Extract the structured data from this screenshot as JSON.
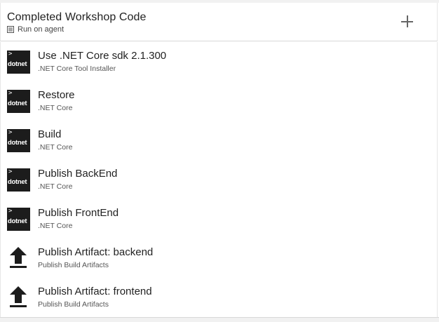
{
  "header": {
    "title": "Completed Workshop Code",
    "subtitle": "Run on agent",
    "subtitle_icon": "server-icon",
    "add_icon": "plus-icon"
  },
  "tasks": [
    {
      "name": "Use .NET Core sdk 2.1.300",
      "description": ".NET Core Tool Installer",
      "icon": "dotnet-icon",
      "icon_label": "dotnet",
      "icon_prompt": ">"
    },
    {
      "name": "Restore",
      "description": ".NET Core",
      "icon": "dotnet-icon",
      "icon_label": "dotnet",
      "icon_prompt": ">"
    },
    {
      "name": "Build",
      "description": ".NET Core",
      "icon": "dotnet-icon",
      "icon_label": "dotnet",
      "icon_prompt": ">"
    },
    {
      "name": "Publish BackEnd",
      "description": ".NET Core",
      "icon": "dotnet-icon",
      "icon_label": "dotnet",
      "icon_prompt": ">"
    },
    {
      "name": "Publish FrontEnd",
      "description": ".NET Core",
      "icon": "dotnet-icon",
      "icon_label": "dotnet",
      "icon_prompt": ">"
    },
    {
      "name": "Publish Artifact: backend",
      "description": "Publish Build Artifacts",
      "icon": "upload-icon"
    },
    {
      "name": "Publish Artifact: frontend",
      "description": "Publish Build Artifacts",
      "icon": "upload-icon"
    }
  ]
}
